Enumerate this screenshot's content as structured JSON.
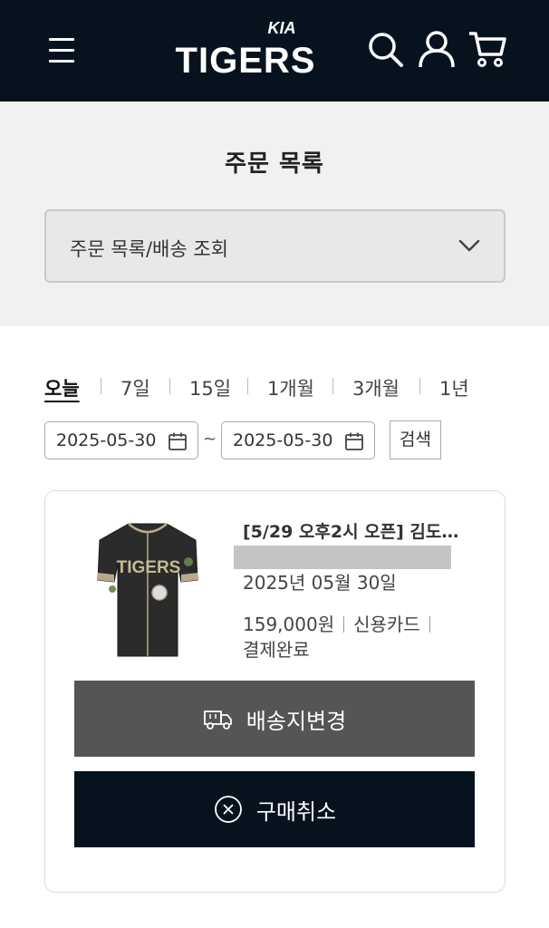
{
  "header": {
    "brand_sub": "KIA",
    "brand": "TIGERS",
    "icons": [
      "menu-icon",
      "search-icon",
      "user-icon",
      "cart-icon"
    ]
  },
  "page": {
    "title": "주문 목록",
    "select_value": "주문 목록/배송 조회"
  },
  "filter": {
    "periods": [
      "오늘",
      "7일",
      "15일",
      "1개월",
      "3개월",
      "1년"
    ],
    "active_period": "오늘",
    "start_date": "2025-05-30",
    "end_date": "2025-05-30",
    "separator": "~",
    "search_label": "검색"
  },
  "order": {
    "product_name": "[5/29 오후2시 오픈] 김도…",
    "order_date": "2025년 05월 30일",
    "price": "159,000원",
    "payment_method": "신용카드",
    "payment_status": "결제완료",
    "change_address_label": "배송지변경",
    "cancel_label": "구매취소"
  },
  "colors": {
    "header_bg": "#06131f",
    "change_btn_bg": "#545557",
    "cancel_btn_bg": "#06131f"
  }
}
